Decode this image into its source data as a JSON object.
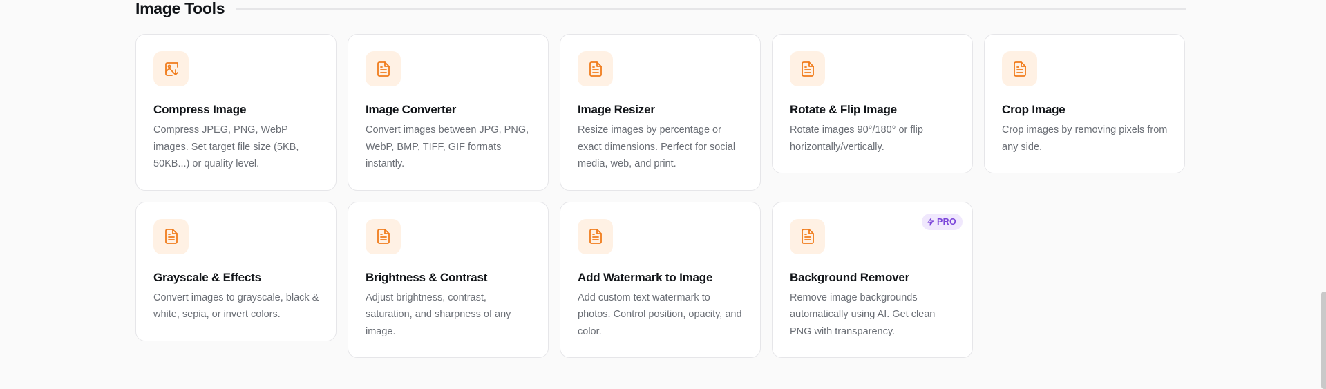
{
  "section": {
    "title": "Image Tools"
  },
  "colors": {
    "accent": "#f07c1c",
    "icon_tile_bg": "#fff1e4",
    "pro_badge_bg": "#f0e8fd",
    "pro_badge_text": "#7b45d9"
  },
  "tools": [
    {
      "id": "compress-image",
      "icon": "image-compress-icon",
      "title": "Compress Image",
      "description": "Compress JPEG, PNG, WebP images. Set target file size (5KB, 50KB...) or quality level."
    },
    {
      "id": "image-converter",
      "icon": "file-document-icon",
      "title": "Image Converter",
      "description": "Convert images between JPG, PNG, WebP, BMP, TIFF, GIF formats instantly."
    },
    {
      "id": "image-resizer",
      "icon": "file-document-icon",
      "title": "Image Resizer",
      "description": "Resize images by percentage or exact dimensions. Perfect for social media, web, and print."
    },
    {
      "id": "rotate-flip-image",
      "icon": "file-document-icon",
      "title": "Rotate & Flip Image",
      "description": "Rotate images 90°/180° or flip horizontally/vertically."
    },
    {
      "id": "crop-image",
      "icon": "file-document-icon",
      "title": "Crop Image",
      "description": "Crop images by removing pixels from any side."
    },
    {
      "id": "grayscale-effects",
      "icon": "file-document-icon",
      "title": "Grayscale & Effects",
      "description": "Convert images to grayscale, black & white, sepia, or invert colors."
    },
    {
      "id": "brightness-contrast",
      "icon": "file-document-icon",
      "title": "Brightness & Contrast",
      "description": "Adjust brightness, contrast, saturation, and sharpness of any image."
    },
    {
      "id": "add-watermark",
      "icon": "file-document-icon",
      "title": "Add Watermark to Image",
      "description": "Add custom text watermark to photos. Control position, opacity, and color."
    },
    {
      "id": "background-remover",
      "icon": "file-document-icon",
      "title": "Background Remover",
      "description": "Remove image backgrounds automatically using AI. Get clean PNG with transparency.",
      "badge": {
        "icon": "lightning-icon",
        "label": "PRO"
      }
    }
  ]
}
